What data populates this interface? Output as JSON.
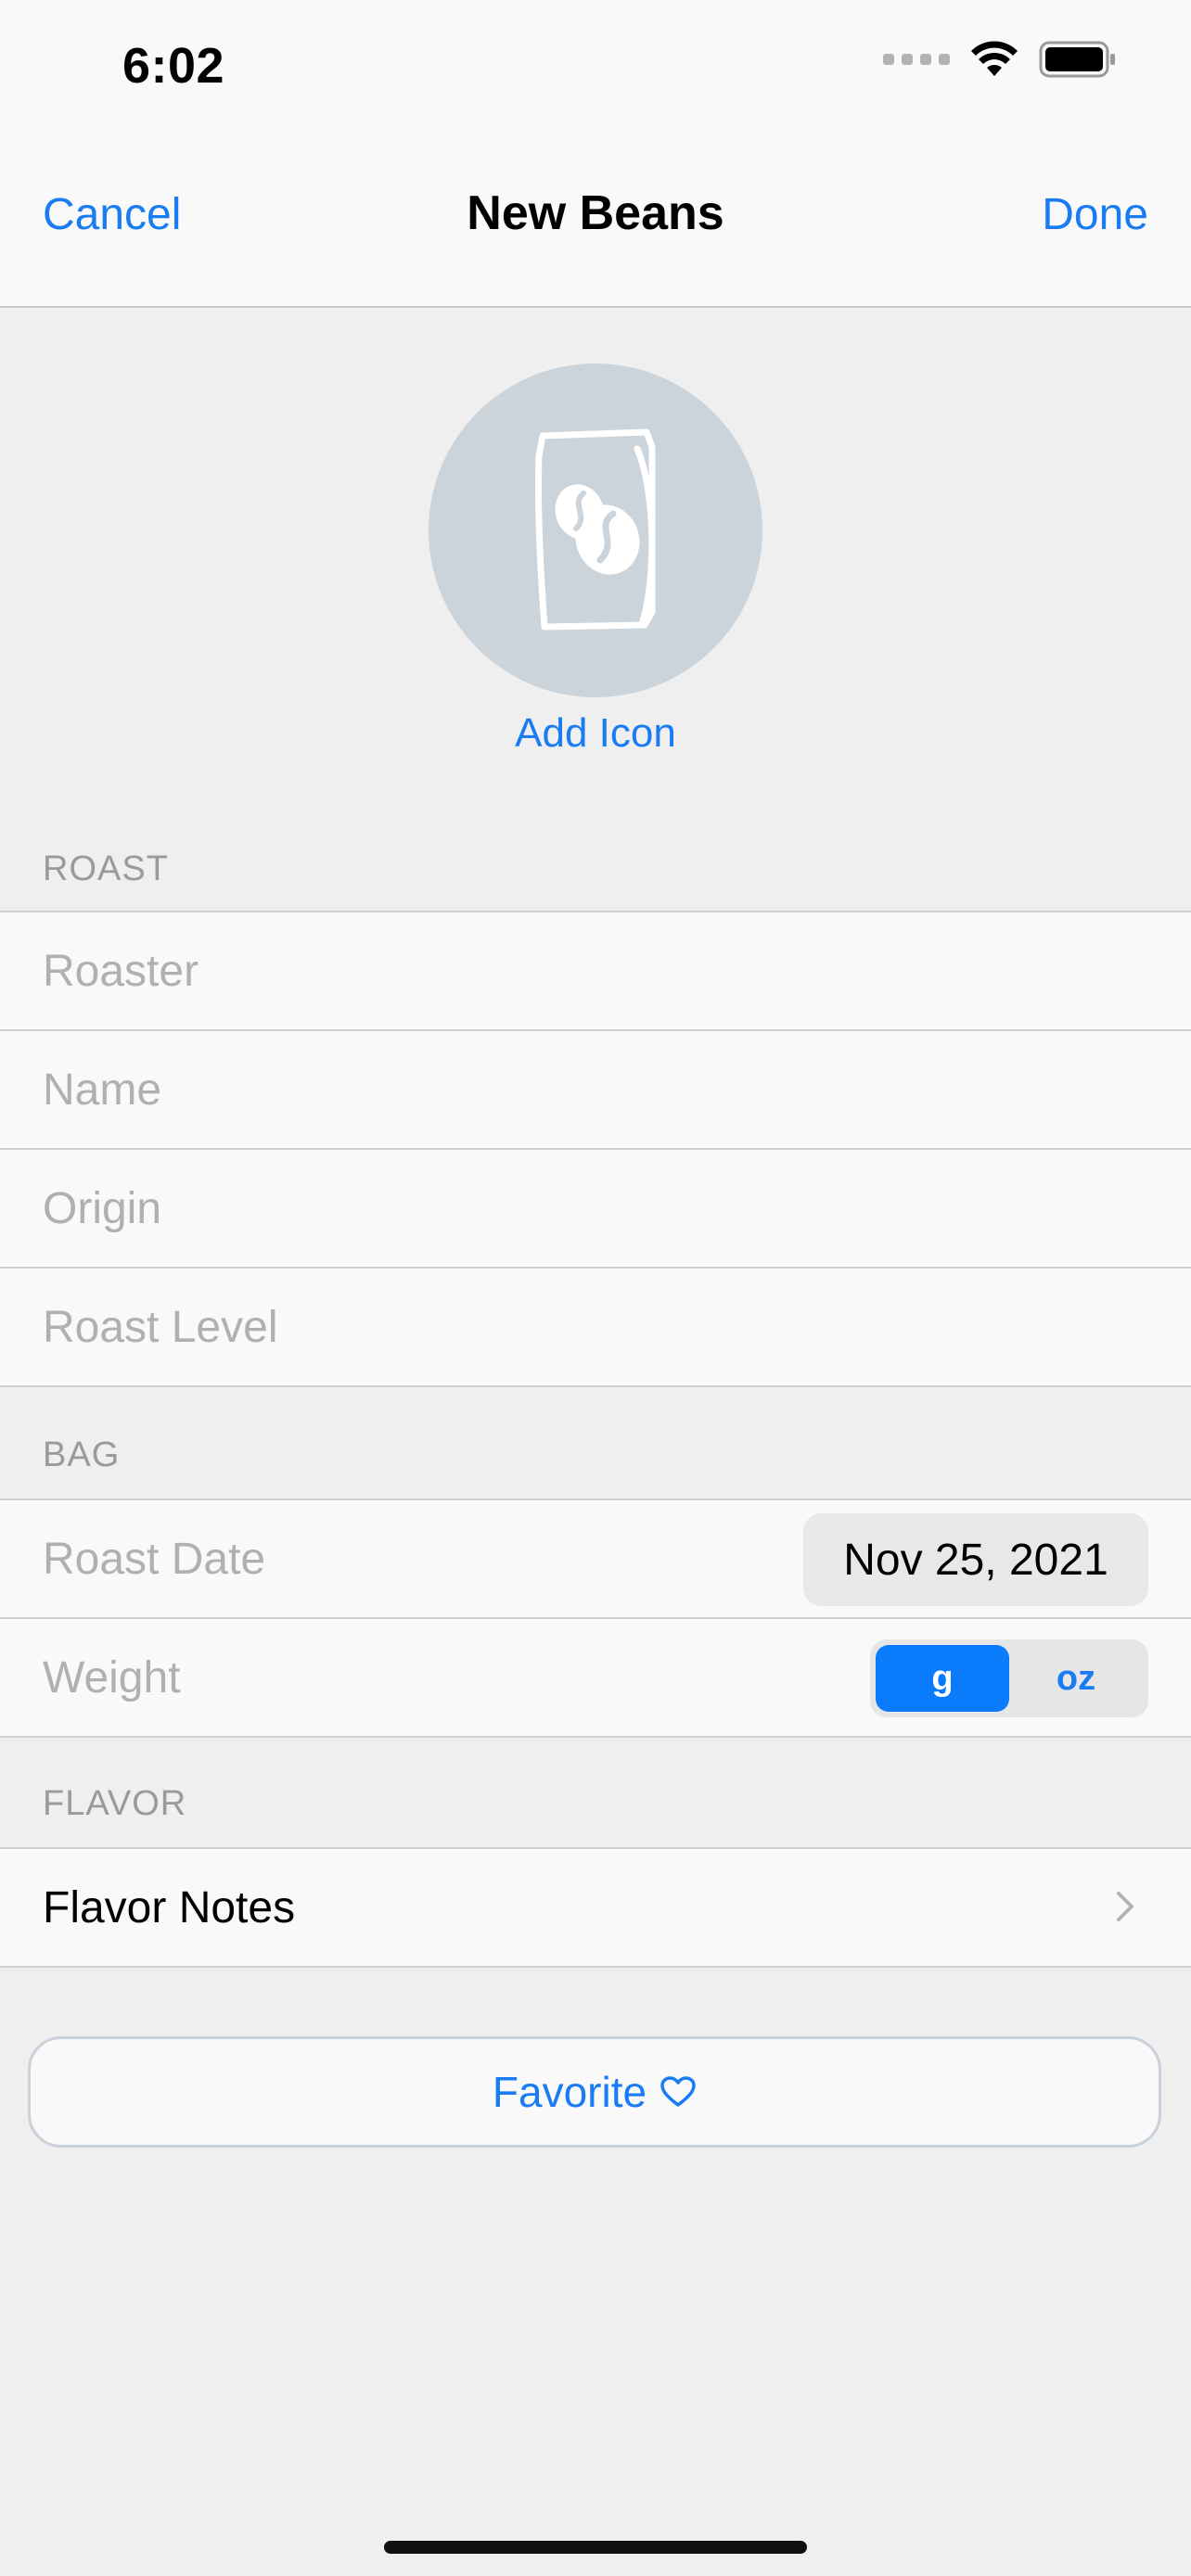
{
  "status_bar": {
    "time": "6:02"
  },
  "nav": {
    "cancel_label": "Cancel",
    "title": "New Beans",
    "done_label": "Done"
  },
  "icon_picker": {
    "icon": "coffee-bag-icon",
    "add_label": "Add Icon"
  },
  "sections": {
    "roast": {
      "header": "ROAST",
      "fields": [
        {
          "placeholder": "Roaster",
          "value": ""
        },
        {
          "placeholder": "Name",
          "value": ""
        },
        {
          "placeholder": "Origin",
          "value": ""
        },
        {
          "placeholder": "Roast Level",
          "value": ""
        }
      ]
    },
    "bag": {
      "header": "BAG",
      "roast_date_label": "Roast Date",
      "roast_date_value": "Nov 25, 2021",
      "weight_label": "Weight",
      "units": [
        "g",
        "oz"
      ],
      "selected_unit": "g"
    },
    "flavor": {
      "header": "FLAVOR",
      "flavor_notes_label": "Flavor Notes"
    }
  },
  "favorite": {
    "label": "Favorite",
    "icon": "heart-outline-icon"
  },
  "colors": {
    "accent": "#1a7cf2",
    "selected_segment": "#0a7bfa",
    "placeholder": "#b0b0b0",
    "icon_circle": "#cbd3db"
  }
}
